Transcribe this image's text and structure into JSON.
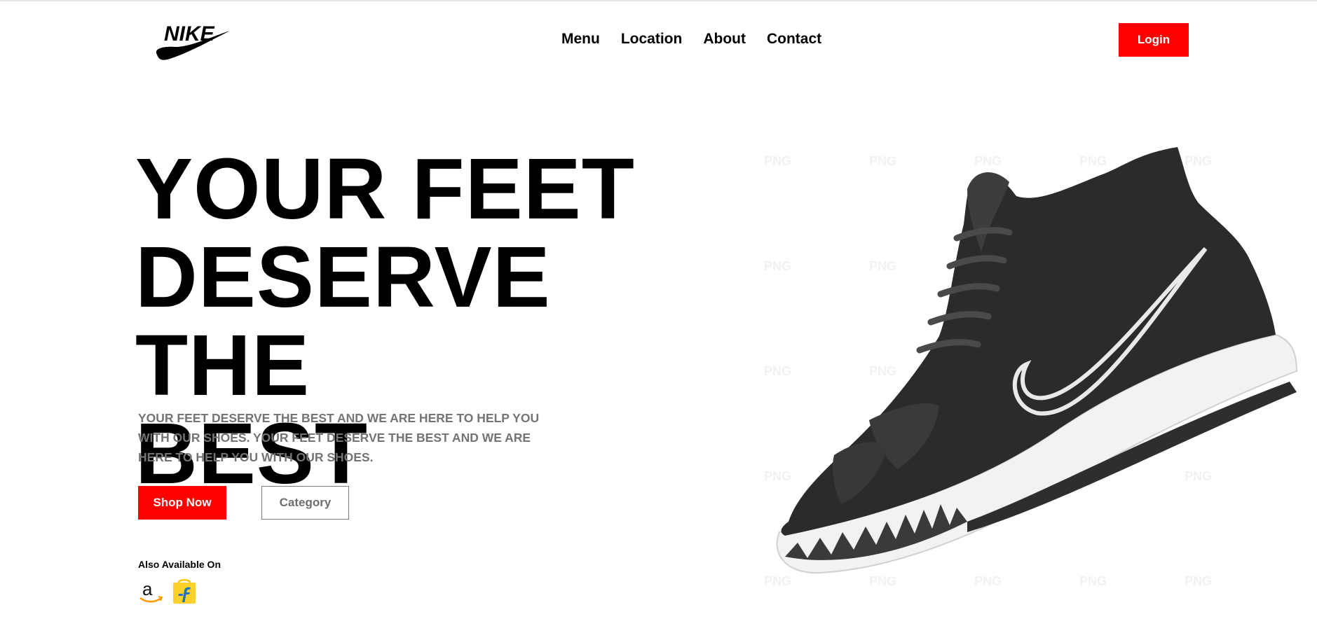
{
  "brand": {
    "logo_text": "NIKE"
  },
  "nav": {
    "items": [
      "Menu",
      "Location",
      "About",
      "Contact"
    ],
    "login_label": "Login"
  },
  "hero": {
    "headline_lines": [
      "YOUR FEET",
      "DESERVE THE",
      "BEST"
    ],
    "description": "YOUR FEET DESERVE THE BEST AND WE ARE HERE TO HELP YOU WITH OUR SHOES. YOUR FEET DESERVE THE BEST AND WE ARE HERE TO HELP YOU WITH OUR SHOES.",
    "shop_label": "Shop Now",
    "category_label": "Category",
    "also_available": "Also Available On",
    "stores": [
      {
        "icon": "amazon-icon"
      },
      {
        "icon": "flipkart-icon"
      }
    ]
  },
  "colors": {
    "accent": "#fe0000",
    "text": "#000000",
    "muted": "#747474",
    "shoe_dark": "#2b2b2d",
    "shoe_sole": "#ffffff"
  },
  "image": {
    "icon": "sneaker-image"
  }
}
